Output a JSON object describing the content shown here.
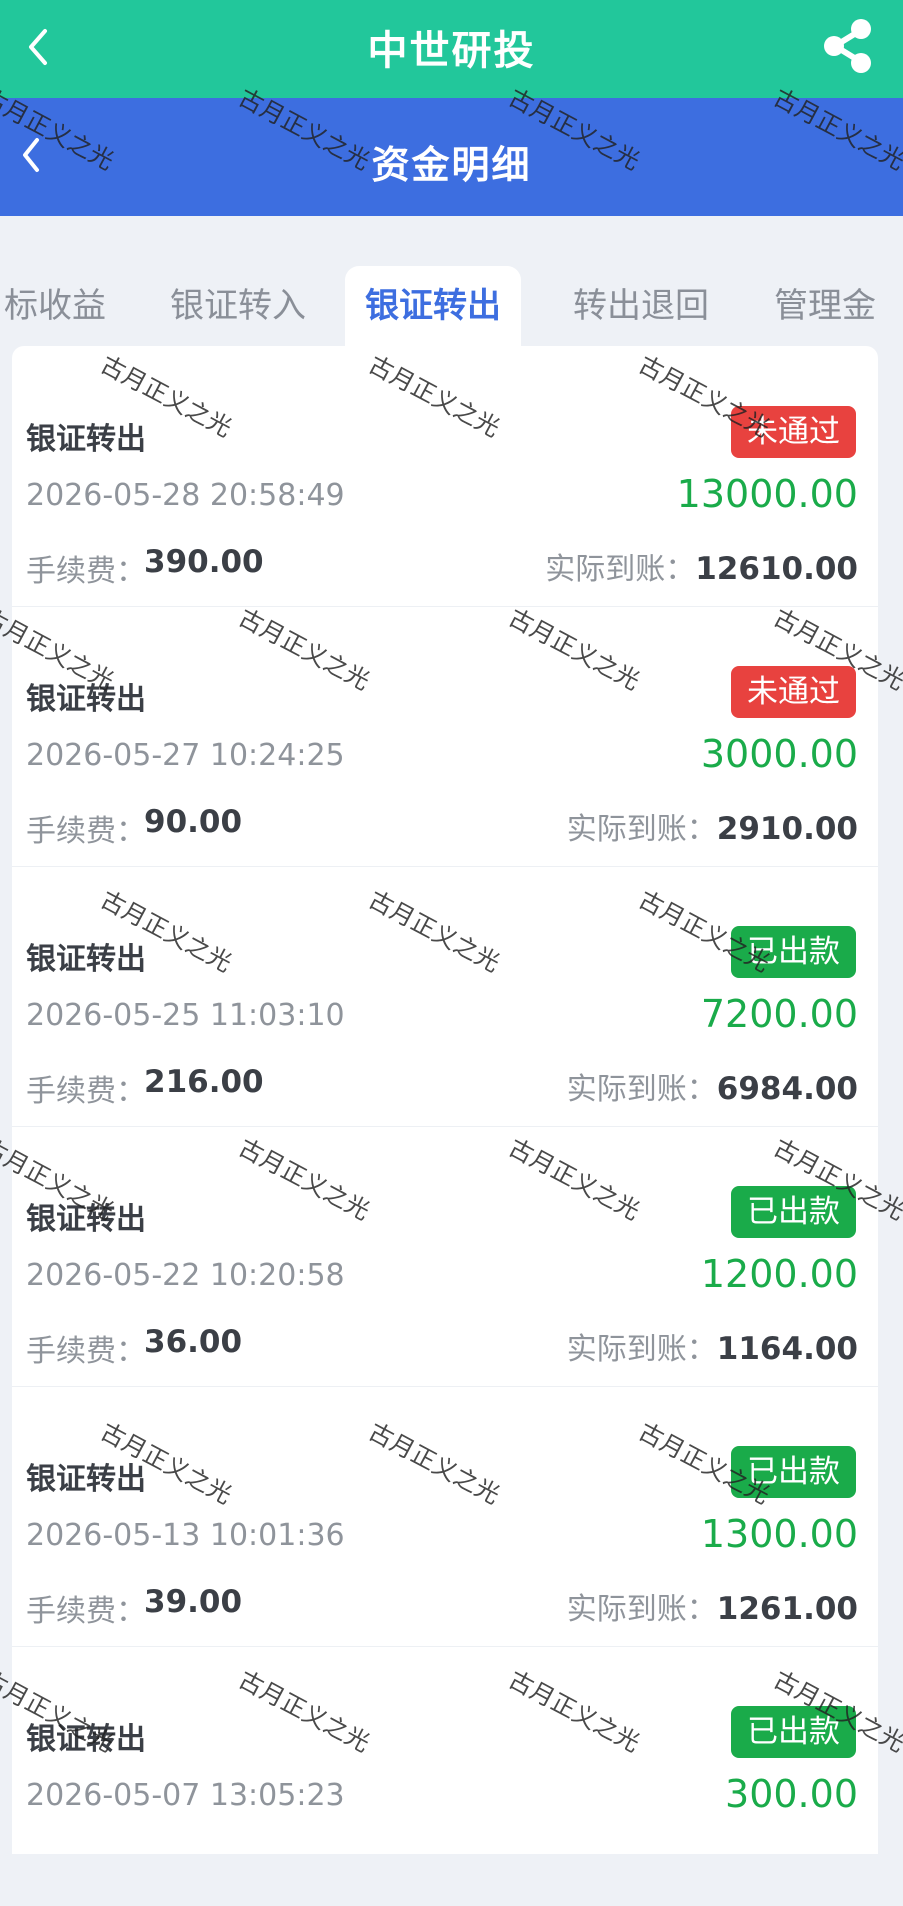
{
  "app_header": {
    "title": "中世研投"
  },
  "sub_header": {
    "title": "资金明细"
  },
  "tabs": [
    "标收益",
    "银证转入",
    "银证转出",
    "转出退回",
    "管理金"
  ],
  "active_tab_index": 2,
  "records": [
    {
      "name": "银证转出",
      "time": "2026-05-28 20:58:49",
      "status": "未通过",
      "amount": "13000.00",
      "fee_label": "手续费：",
      "fee": "390.00",
      "actual_label": "实际到账：",
      "actual": "12610.00"
    },
    {
      "name": "银证转出",
      "time": "2026-05-27 10:24:25",
      "status": "未通过",
      "amount": "3000.00",
      "fee_label": "手续费：",
      "fee": "90.00",
      "actual_label": "实际到账：",
      "actual": "2910.00"
    },
    {
      "name": "银证转出",
      "time": "2026-05-25 11:03:10",
      "status": "已出款",
      "amount": "7200.00",
      "fee_label": "手续费：",
      "fee": "216.00",
      "actual_label": "实际到账：",
      "actual": "6984.00"
    },
    {
      "name": "银证转出",
      "time": "2026-05-22 10:20:58",
      "status": "已出款",
      "amount": "1200.00",
      "fee_label": "手续费：",
      "fee": "36.00",
      "actual_label": "实际到账：",
      "actual": "1164.00"
    },
    {
      "name": "银证转出",
      "time": "2026-05-13 10:01:36",
      "status": "已出款",
      "amount": "1300.00",
      "fee_label": "手续费：",
      "fee": "39.00",
      "actual_label": "实际到账：",
      "actual": "1261.00"
    },
    {
      "name": "银证转出",
      "time": "2026-05-07 13:05:23",
      "status": "已出款",
      "amount": "300.00"
    }
  ],
  "watermark": {
    "text": "古月正义之光"
  },
  "colors": {
    "header_green": "#22c79b",
    "header_blue": "#3d6ee0",
    "status_fail": "#e8423f",
    "status_ok": "#1aab4a",
    "amount_green": "#1aab4a"
  },
  "icons": {
    "back": "chevron-left-icon",
    "share": "share-icon"
  }
}
